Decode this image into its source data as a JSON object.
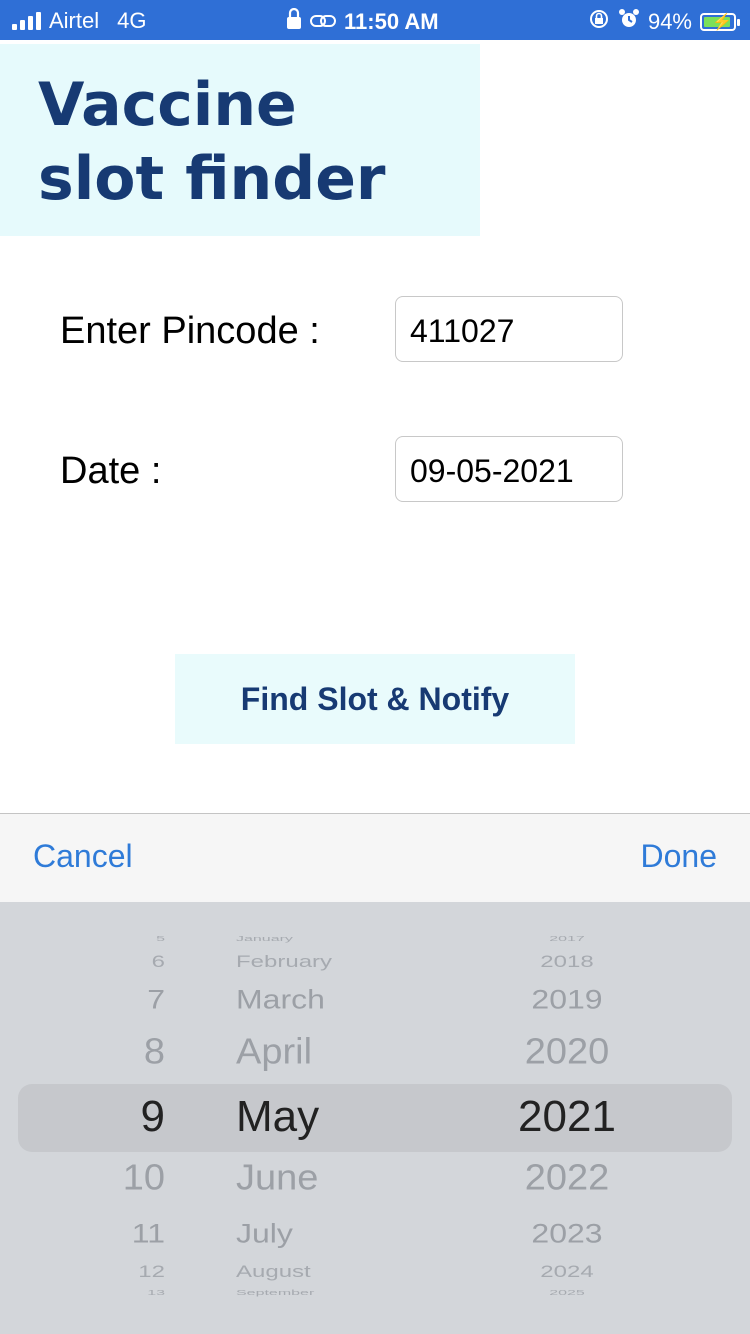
{
  "status_bar": {
    "carrier": "Airtel",
    "network": "4G",
    "time": "11:50 AM",
    "battery": "94%",
    "battery_level": 0.94
  },
  "header": {
    "title_line1": "Vaccine",
    "title_line2": "slot finder"
  },
  "form": {
    "pincode_label": "Enter Pincode :",
    "pincode_value": "411027",
    "date_label": "Date :",
    "date_value": "09-05-2021"
  },
  "action": {
    "find_label": "Find Slot & Notify"
  },
  "toolbar": {
    "cancel_label": "Cancel",
    "done_label": "Done"
  },
  "picker": {
    "days": [
      "5",
      "6",
      "7",
      "8",
      "9",
      "10",
      "11",
      "12",
      "13"
    ],
    "months": [
      "January",
      "February",
      "March",
      "April",
      "May",
      "June",
      "July",
      "August",
      "September"
    ],
    "years": [
      "2017",
      "2018",
      "2019",
      "2020",
      "2021",
      "2022",
      "2023",
      "2024",
      "2025"
    ],
    "selected_index": 4
  }
}
